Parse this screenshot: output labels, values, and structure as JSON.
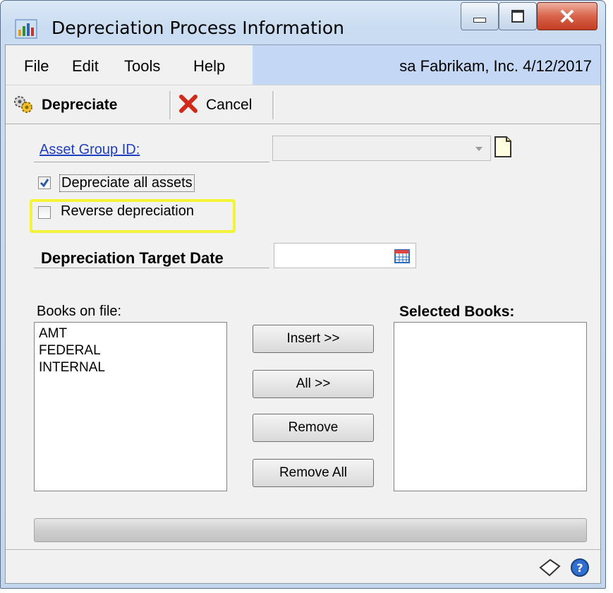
{
  "window": {
    "title": "Depreciation Process Information",
    "controls": {
      "minimize_icon": "minimize-icon",
      "maximize_icon": "maximize-icon",
      "close_icon": "close-icon"
    }
  },
  "menu": {
    "items": [
      "File",
      "Edit",
      "Tools",
      "Help"
    ],
    "user_info": "sa  Fabrikam, Inc.  4/12/2017"
  },
  "toolbar": {
    "depreciate_label": "Depreciate",
    "cancel_label": "Cancel"
  },
  "form": {
    "asset_group_label": "Asset Group ID:",
    "asset_group_value": "",
    "depreciate_all": {
      "label": "Depreciate all assets",
      "checked": true
    },
    "reverse": {
      "label": "Reverse depreciation",
      "checked": false
    },
    "target_date_label": "Depreciation Target Date",
    "target_date_value": ""
  },
  "books": {
    "on_file_label": "Books on file:",
    "on_file": [
      "AMT",
      "FEDERAL",
      "INTERNAL"
    ],
    "selected_label": "Selected Books:",
    "selected": []
  },
  "buttons": {
    "insert": "Insert >>",
    "all": "All >>",
    "remove": "Remove",
    "remove_all": "Remove All"
  },
  "colors": {
    "highlight": "#f3f33a",
    "link": "#1e3fbf",
    "menubar_user_bg": "#c4d8f5"
  }
}
